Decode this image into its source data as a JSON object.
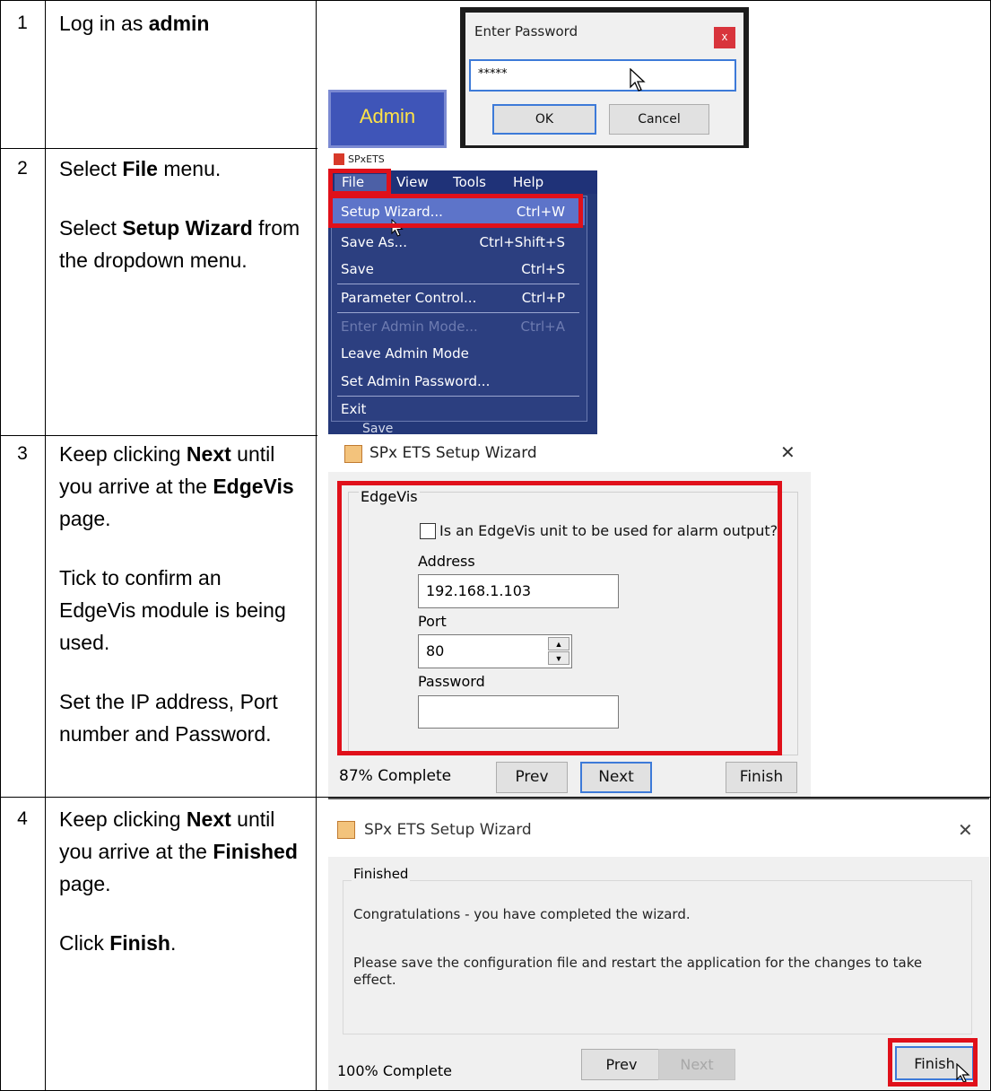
{
  "rows": [
    {
      "num": "1",
      "text": [
        [
          "Log in as ",
          {
            "b": "admin"
          }
        ]
      ]
    },
    {
      "num": "2",
      "text": [
        [
          "Select ",
          {
            "b": "File"
          },
          " menu."
        ],
        [
          "Select ",
          {
            "b": "Setup Wizard"
          },
          " from the dropdown menu."
        ]
      ]
    },
    {
      "num": "3",
      "text": [
        [
          "Keep clicking ",
          {
            "b": "Next"
          },
          " until you arrive at the ",
          {
            "b": "EdgeVis"
          },
          " page."
        ],
        [
          "Tick to confirm an EdgeVis module is being used."
        ],
        [
          "Set the IP address, Port number and Password."
        ]
      ]
    },
    {
      "num": "4",
      "text": [
        [
          "Keep clicking ",
          {
            "b": "Next"
          },
          " until you arrive at the ",
          {
            "b": "Finished"
          },
          " page."
        ],
        [
          "Click ",
          {
            "b": "Finish"
          },
          "."
        ]
      ]
    }
  ],
  "login": {
    "admin_label": "Admin",
    "dialog_title": "Enter Password",
    "close_glyph": "x",
    "password_mask": "*****",
    "ok_label": "OK",
    "cancel_label": "Cancel"
  },
  "menu": {
    "app_title": "SPxETS",
    "bar": [
      "File",
      "View",
      "Tools",
      "Help"
    ],
    "items": [
      {
        "label": "Setup Wizard...",
        "shortcut": "Ctrl+W",
        "disabled": false,
        "separator_after": false
      },
      {
        "label": "Save As...",
        "shortcut": "Ctrl+Shift+S",
        "disabled": false,
        "separator_after": false
      },
      {
        "label": "Save",
        "shortcut": "Ctrl+S",
        "disabled": false,
        "separator_after": true
      },
      {
        "label": "Parameter Control...",
        "shortcut": "Ctrl+P",
        "disabled": false,
        "separator_after": true
      },
      {
        "label": "Enter Admin Mode...",
        "shortcut": "Ctrl+A",
        "disabled": true,
        "separator_after": false
      },
      {
        "label": "Leave Admin Mode",
        "shortcut": "",
        "disabled": false,
        "separator_after": false
      },
      {
        "label": "Set Admin Password...",
        "shortcut": "",
        "disabled": false,
        "separator_after": true
      },
      {
        "label": "Exit",
        "shortcut": "",
        "disabled": false,
        "separator_after": false
      }
    ],
    "below_text": "Save"
  },
  "wizard_edgevis": {
    "title": "SPx ETS Setup Wizard",
    "close_glyph": "✕",
    "group_label": "EdgeVis",
    "checkbox_label": "Is an EdgeVis unit to be used for alarm output?",
    "checkbox_checked": false,
    "address_label": "Address",
    "address_value": "192.168.1.103",
    "port_label": "Port",
    "port_value": "80",
    "password_label": "Password",
    "password_value": "",
    "progress": "87% Complete",
    "prev_label": "Prev",
    "next_label": "Next",
    "finish_label": "Finish"
  },
  "wizard_finished": {
    "title": "SPx ETS Setup Wizard",
    "close_glyph": "✕",
    "group_label": "Finished",
    "line1": "Congratulations - you have completed the wizard.",
    "line2": "Please save the configuration file and restart the application for the changes to take effect.",
    "progress": "100% Complete",
    "prev_label": "Prev",
    "next_label": "Next",
    "finish_label": "Finish"
  },
  "colors": {
    "highlight_red": "#e0101a",
    "menu_blue": "#2c3f80",
    "menu_bar_blue": "#1f3278",
    "admin_button_blue": "#3f55b8",
    "admin_text_yellow": "#ffe347"
  }
}
